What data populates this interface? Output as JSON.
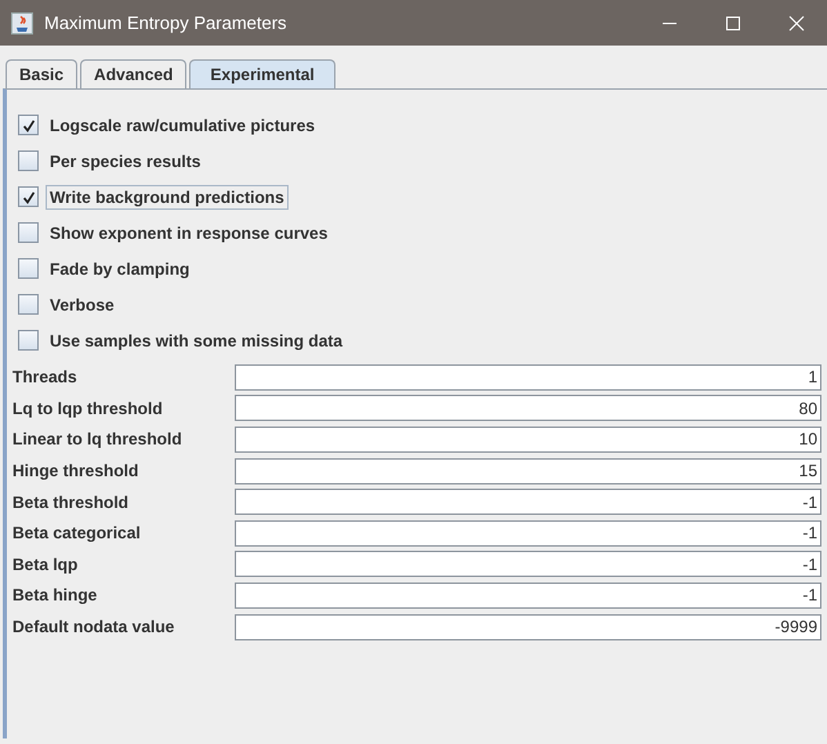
{
  "window": {
    "title": "Maximum Entropy Parameters"
  },
  "tabs": [
    {
      "label": "Basic",
      "selected": false
    },
    {
      "label": "Advanced",
      "selected": false
    },
    {
      "label": "Experimental",
      "selected": true
    }
  ],
  "options": [
    {
      "label": "Logscale raw/cumulative pictures",
      "checked": true,
      "focused": false
    },
    {
      "label": "Per species results",
      "checked": false,
      "focused": false
    },
    {
      "label": "Write background predictions",
      "checked": true,
      "focused": true
    },
    {
      "label": "Show exponent in response curves",
      "checked": false,
      "focused": false
    },
    {
      "label": "Fade by clamping",
      "checked": false,
      "focused": false
    },
    {
      "label": "Verbose",
      "checked": false,
      "focused": false
    },
    {
      "label": "Use samples with some missing data",
      "checked": false,
      "focused": false
    }
  ],
  "fields": [
    {
      "label": "Threads",
      "value": "1"
    },
    {
      "label": "Lq to lqp threshold",
      "value": "80"
    },
    {
      "label": "Linear to lq threshold",
      "value": "10"
    },
    {
      "label": "Hinge threshold",
      "value": "15"
    },
    {
      "label": "Beta threshold",
      "value": "-1"
    },
    {
      "label": "Beta categorical",
      "value": "-1"
    },
    {
      "label": "Beta lqp",
      "value": "-1"
    },
    {
      "label": "Beta hinge",
      "value": "-1"
    },
    {
      "label": "Default nodata value",
      "value": "-9999"
    }
  ]
}
